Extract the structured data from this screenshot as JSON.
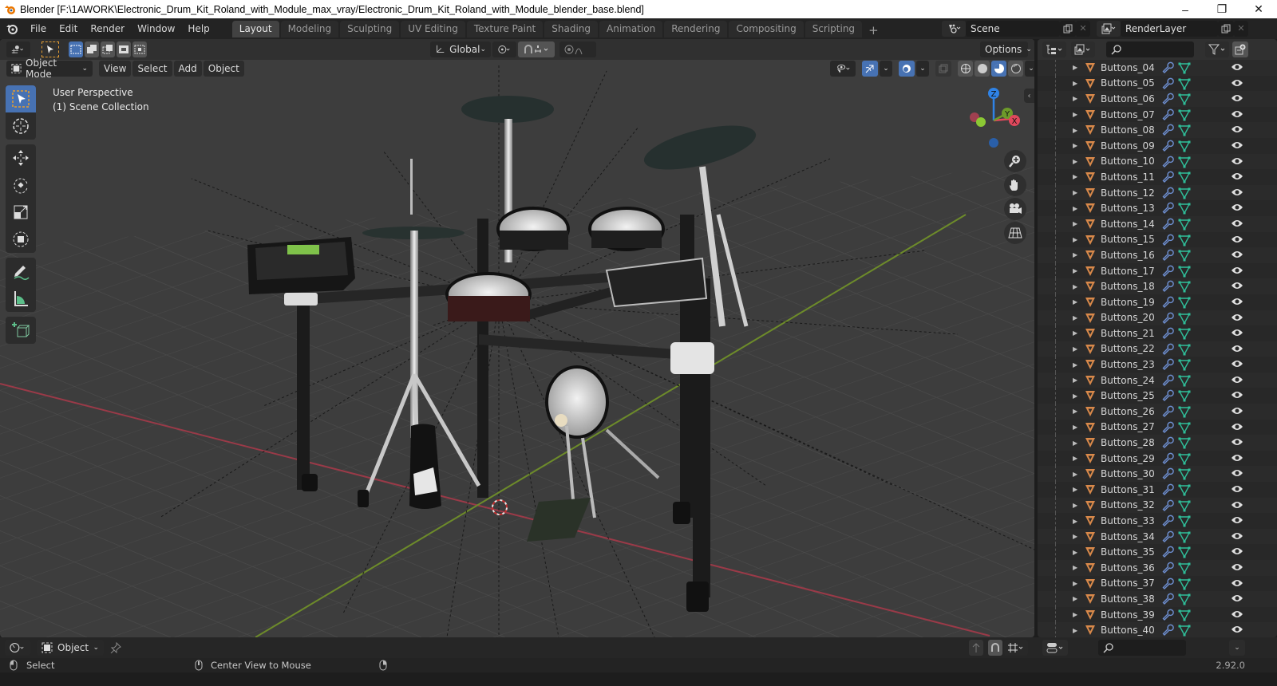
{
  "window": {
    "title": "Blender [F:\\1AWORK\\Electronic_Drum_Kit_Roland_with_Module_max_vray/Electronic_Drum_Kit_Roland_with_Module_blender_base.blend]",
    "controls": {
      "minimize": "–",
      "maximize": "❐",
      "close": "✕"
    }
  },
  "menu": [
    "File",
    "Edit",
    "Render",
    "Window",
    "Help"
  ],
  "workspaces": {
    "tabs": [
      "Layout",
      "Modeling",
      "Sculpting",
      "UV Editing",
      "Texture Paint",
      "Shading",
      "Animation",
      "Rendering",
      "Compositing",
      "Scripting"
    ],
    "active": "Layout",
    "add": "+"
  },
  "scene": {
    "name": "Scene",
    "render_layer": "RenderLayer"
  },
  "viewport": {
    "transform_orientation": "Global",
    "options_label": "Options",
    "mode": "Object Mode",
    "header_menus": [
      "View",
      "Select",
      "Add",
      "Object"
    ],
    "info_line1": "User Perspective",
    "info_line2": "(1) Scene Collection",
    "gizmo_axes": {
      "x": "X",
      "y": "Y",
      "z": "Z"
    },
    "colors": {
      "x_axis": "#e0485c",
      "y_axis": "#8bc834",
      "z_axis": "#2f83e6",
      "accent": "#4772b3",
      "grid": "#4a4a4a",
      "background": "#3d3d3d"
    }
  },
  "tools": [
    "select-box",
    "cursor",
    "move",
    "rotate",
    "scale",
    "transform",
    "annotate",
    "measure",
    "add-cube"
  ],
  "outliner": {
    "search_placeholder": "",
    "items": [
      "Buttons_04",
      "Buttons_05",
      "Buttons_06",
      "Buttons_07",
      "Buttons_08",
      "Buttons_09",
      "Buttons_10",
      "Buttons_11",
      "Buttons_12",
      "Buttons_13",
      "Buttons_14",
      "Buttons_15",
      "Buttons_16",
      "Buttons_17",
      "Buttons_18",
      "Buttons_19",
      "Buttons_20",
      "Buttons_21",
      "Buttons_22",
      "Buttons_23",
      "Buttons_24",
      "Buttons_25",
      "Buttons_26",
      "Buttons_27",
      "Buttons_28",
      "Buttons_29",
      "Buttons_30",
      "Buttons_31",
      "Buttons_32",
      "Buttons_33",
      "Buttons_34",
      "Buttons_35",
      "Buttons_36",
      "Buttons_37",
      "Buttons_38",
      "Buttons_39",
      "Buttons_40"
    ],
    "colors": {
      "mesh_icon": "#d9894a",
      "modifier_icon": "#6e8fd1",
      "vertex_icon": "#2fbf9a"
    }
  },
  "bottom": {
    "editor_mode": "Object"
  },
  "status": {
    "left_action": "Select",
    "middle_action": "Center View to Mouse",
    "version": "2.92.0"
  }
}
